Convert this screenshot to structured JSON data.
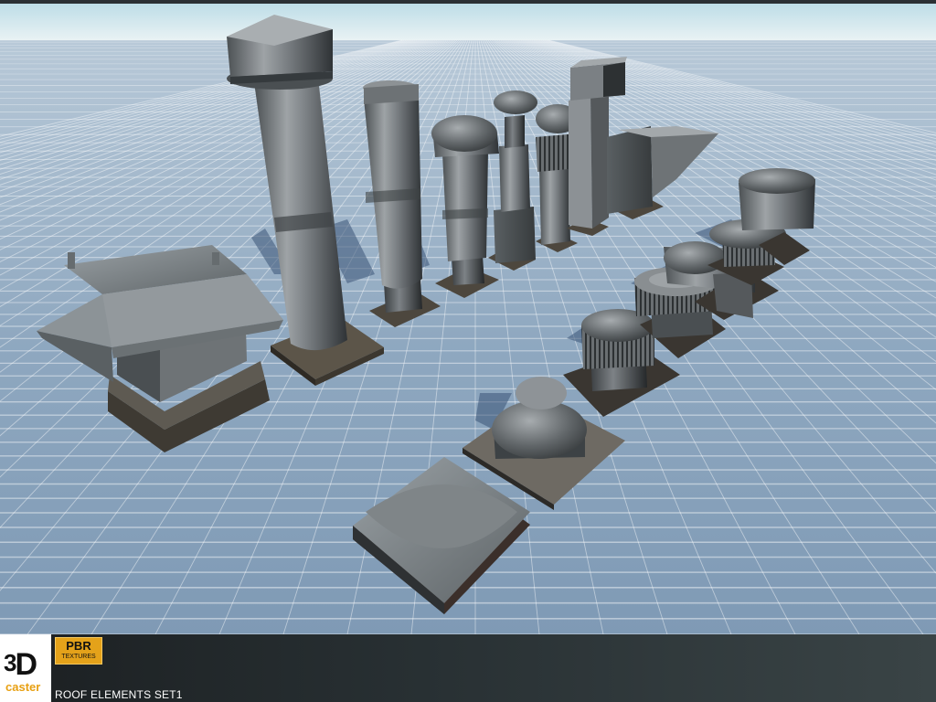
{
  "logo": {
    "big": "3",
    "d": "D",
    "small": "caster"
  },
  "badge": {
    "top": "PBR",
    "bottom": "TEXTURES"
  },
  "caption": "ROOF ELEMENTS SET1"
}
